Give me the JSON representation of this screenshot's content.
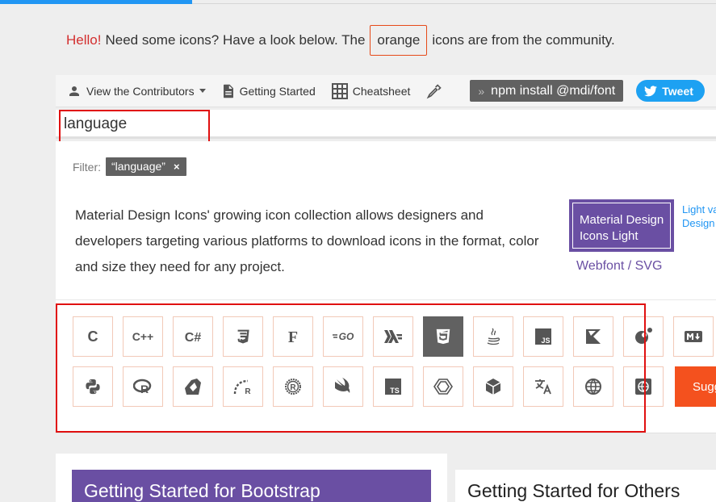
{
  "intro": {
    "hello": "Hello!",
    "text1": "Need some icons? Have a look below. The",
    "highlight": "orange",
    "text2": "icons are from the community."
  },
  "toolbar": {
    "contributors_label": "View the Contributors",
    "getting_started_label": "Getting Started",
    "cheatsheet_label": "Cheatsheet",
    "npm_label": "npm install @mdi/font",
    "tweet_label": "Tweet"
  },
  "search": {
    "value": "language",
    "placeholder": ""
  },
  "filter": {
    "label": "Filter:",
    "chip": "“language”",
    "remove": "×"
  },
  "description": "Material Design Icons' growing icon collection allows designers and developers targeting various platforms to download icons in the format, color and size they need for any project.",
  "promo": {
    "title_line1": "Material Design",
    "title_line2": "Icons Light",
    "subtitle": "Webfont / SVG",
    "link_line1": "Light va",
    "link_line2": "Design"
  },
  "icons": {
    "row1": [
      "language-c-icon",
      "language-cpp-icon",
      "language-csharp-icon",
      "language-css3-icon",
      "language-fortran-icon",
      "language-go-icon",
      "language-haskell-icon",
      "language-html5-icon",
      "language-java-icon",
      "language-javascript-icon",
      "language-kotlin-icon",
      "language-lua-icon",
      "language-markdown-icon"
    ],
    "row2": [
      "language-python-icon",
      "language-r-icon",
      "language-ruby-icon",
      "language-ruby-on-rails-icon",
      "language-rust-icon",
      "language-swift-icon",
      "language-typescript-icon",
      "language-xaml-icon",
      "cube-icon",
      "translate-icon",
      "web-icon",
      "web-box-icon"
    ],
    "active_index": 7
  },
  "suggest_label": "Sugg",
  "cards": {
    "left_title": "Getting Started for Bootstrap",
    "right_title": "Getting Started for Others"
  },
  "colors": {
    "accent_purple": "#6a4fa3",
    "accent_orange": "#f4511e",
    "twitter_blue": "#1da1f2",
    "highlight_red": "#e01010"
  }
}
